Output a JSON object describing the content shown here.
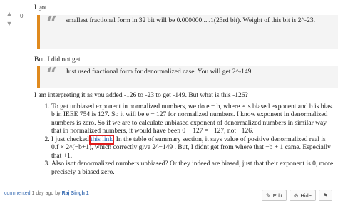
{
  "vote": {
    "up_icon": "chevron-up-icon",
    "down_icon": "chevron-down-icon",
    "score": "0"
  },
  "comment": {
    "line1": "I got",
    "quote1": "smallest fractional form in 32 bit will be 0.000000.....1(23rd bit). Weight of this bit is 2^-23.",
    "line2": "But. I did not get",
    "quote2": "Just used fractional form for denormalized case. You will get 2^-149",
    "line3": "I am interpreting it as you added -126 to -23 to get -149. But what is this -126?",
    "items": [
      "To get unbiased exponent in normalized numbers, we do e − b, where e is biased exponent and b is bias. b in IEEE 754 is 127. So it will be e − 127 for normalized numbers. I know exponent in denormalized numbers is zero. So if we are to calculate unbiased exponent of denormalized numbers in similar way that in normalized numbers, it would have been 0 − 127 = −127, not −126.",
      "I just checked",
      "this link",
      ". In the table of summary section, it says value of positive denormalized real is 0.f × 2^(−b+1), which correctly give 2^−149 . But, I didnt get from where that −b + 1 came. Especially that +1.",
      "Also isnt denormalized numbers unbiased? Or they indeed are biased, just that their exponent is 0, more precisely a biased zero."
    ]
  },
  "footer": {
    "commented": "commented",
    "when": "1 day ago by",
    "user": "Raj Singh 1"
  },
  "actions": {
    "edit": "Edit",
    "hide": "Hide",
    "flag_icon": "flag-icon"
  }
}
